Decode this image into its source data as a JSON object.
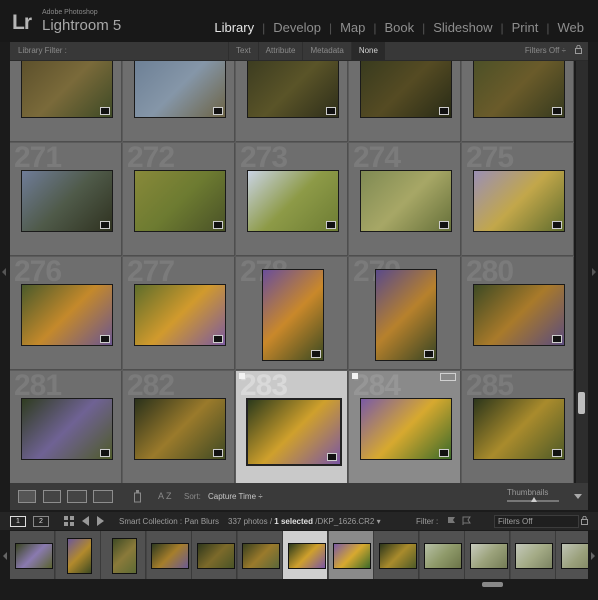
{
  "app": {
    "logo": "Lr",
    "brand_small": "Adobe Photoshop",
    "brand_big": "Lightroom 5",
    "modules": [
      "Library",
      "Develop",
      "Map",
      "Book",
      "Slideshow",
      "Print",
      "Web"
    ],
    "active_module": "Library"
  },
  "filter_bar": {
    "label": "Library Filter :",
    "tabs": [
      "Text",
      "Attribute",
      "Metadata",
      "None"
    ],
    "active_tab": "None",
    "filters_off": "Filters Off ÷"
  },
  "grid": {
    "columns": 5,
    "cells": [
      {
        "number": "",
        "orient": "land",
        "colors": [
          "#5b4f2b",
          "#7a6a3a",
          "#3e4a26"
        ]
      },
      {
        "number": "",
        "orient": "land",
        "colors": [
          "#6c7f95",
          "#8596a8",
          "#6d6446"
        ]
      },
      {
        "number": "",
        "orient": "land",
        "colors": [
          "#3b3b20",
          "#5a5428",
          "#2e2e1a"
        ]
      },
      {
        "number": "",
        "orient": "land",
        "colors": [
          "#373a1e",
          "#554b23",
          "#282b16"
        ]
      },
      {
        "number": "",
        "orient": "land",
        "colors": [
          "#4b5027",
          "#6a5b2a",
          "#363a1e"
        ]
      },
      {
        "number": "271",
        "orient": "land",
        "colors": [
          "#6f7c98",
          "#4f5a49",
          "#2f3220"
        ]
      },
      {
        "number": "272",
        "orient": "land",
        "colors": [
          "#88893a",
          "#6d7b31",
          "#4a5227"
        ]
      },
      {
        "number": "273",
        "orient": "land",
        "colors": [
          "#c9d3e4",
          "#8d9a47",
          "#6e7d34"
        ]
      },
      {
        "number": "274",
        "orient": "land",
        "colors": [
          "#7f8a53",
          "#a7a766",
          "#66703a"
        ]
      },
      {
        "number": "275",
        "orient": "land",
        "colors": [
          "#9a8fb5",
          "#c2a74a",
          "#5f6c2e"
        ]
      },
      {
        "number": "276",
        "orient": "land",
        "colors": [
          "#4a5a2b",
          "#c4892b",
          "#6b5690"
        ]
      },
      {
        "number": "277",
        "orient": "land",
        "colors": [
          "#5e6d2b",
          "#d19a2d",
          "#7b5aa0"
        ]
      },
      {
        "number": "278",
        "orient": "port",
        "colors": [
          "#6a4e9a",
          "#c9882a",
          "#3c4a22"
        ]
      },
      {
        "number": "279",
        "orient": "port",
        "colors": [
          "#5a4a8a",
          "#b7812c",
          "#384524"
        ]
      },
      {
        "number": "280",
        "orient": "land",
        "colors": [
          "#3d4a24",
          "#a97a2a",
          "#5b4c7e"
        ]
      },
      {
        "number": "281",
        "orient": "land",
        "colors": [
          "#2f3c20",
          "#6f6294",
          "#4f5b2a"
        ]
      },
      {
        "number": "282",
        "orient": "land",
        "colors": [
          "#2a311b",
          "#9a7a2b",
          "#404a24"
        ]
      },
      {
        "number": "283",
        "orient": "land",
        "colors": [
          "#2b3a1c",
          "#cfa02c",
          "#7a56a4"
        ],
        "selected": true,
        "flag": true
      },
      {
        "number": "284",
        "orient": "land",
        "colors": [
          "#7a5aa6",
          "#d7a92f",
          "#3b6a2a"
        ],
        "second": true,
        "flag": true,
        "stack": true
      },
      {
        "number": "285",
        "orient": "land",
        "colors": [
          "#2c361b",
          "#a98b2c",
          "#4e5a28"
        ]
      }
    ]
  },
  "toolbar": {
    "sort_label": "Sort:",
    "sort_value": "Capture Time ÷",
    "thumbnails_label": "Thumbnails"
  },
  "filmstrip_header": {
    "screen1": "1",
    "screen2": "2",
    "collection_path": "Smart Collection : Pan Blurs",
    "count_prefix": "337 photos /",
    "count_selected": "1 selected",
    "count_file": "/DKP_1626.CR2 ▾",
    "filter_label": "Filter :",
    "filters_off": "Filters Off"
  },
  "filmstrip": {
    "cells": [
      {
        "orient": "land",
        "colors": [
          "#3a4522",
          "#8a7ab0",
          "#5a6330"
        ]
      },
      {
        "orient": "port",
        "colors": [
          "#6c5898",
          "#b28a2c",
          "#3e4a22"
        ]
      },
      {
        "orient": "port",
        "colors": [
          "#3f4b25",
          "#8a7a3a",
          "#5d6a34"
        ]
      },
      {
        "orient": "land",
        "colors": [
          "#2e3a1f",
          "#a67e2b",
          "#6b5a93"
        ]
      },
      {
        "orient": "land",
        "colors": [
          "#2f381c",
          "#7c6a2a",
          "#4a5427"
        ]
      },
      {
        "orient": "land",
        "colors": [
          "#39401f",
          "#9a7a2b",
          "#5c683a"
        ]
      },
      {
        "orient": "land",
        "colors": [
          "#2b3a1c",
          "#cfa02c",
          "#7a56a4"
        ],
        "selected": true
      },
      {
        "orient": "land",
        "colors": [
          "#7a5aa6",
          "#d7a92f",
          "#3b6a2a"
        ],
        "second": true
      },
      {
        "orient": "land",
        "colors": [
          "#2c361b",
          "#a98b2c",
          "#4e5a28"
        ]
      },
      {
        "orient": "land",
        "colors": [
          "#b7c0a7",
          "#8f9a6a",
          "#6b7448"
        ]
      },
      {
        "orient": "land",
        "colors": [
          "#c8ccbf",
          "#9ba27b",
          "#747c55"
        ]
      },
      {
        "orient": "land",
        "colors": [
          "#c3c8bb",
          "#a4ab86",
          "#7b8361"
        ]
      },
      {
        "orient": "land",
        "colors": [
          "#bfc4b6",
          "#9aa07b",
          "#7a805c"
        ]
      }
    ]
  }
}
